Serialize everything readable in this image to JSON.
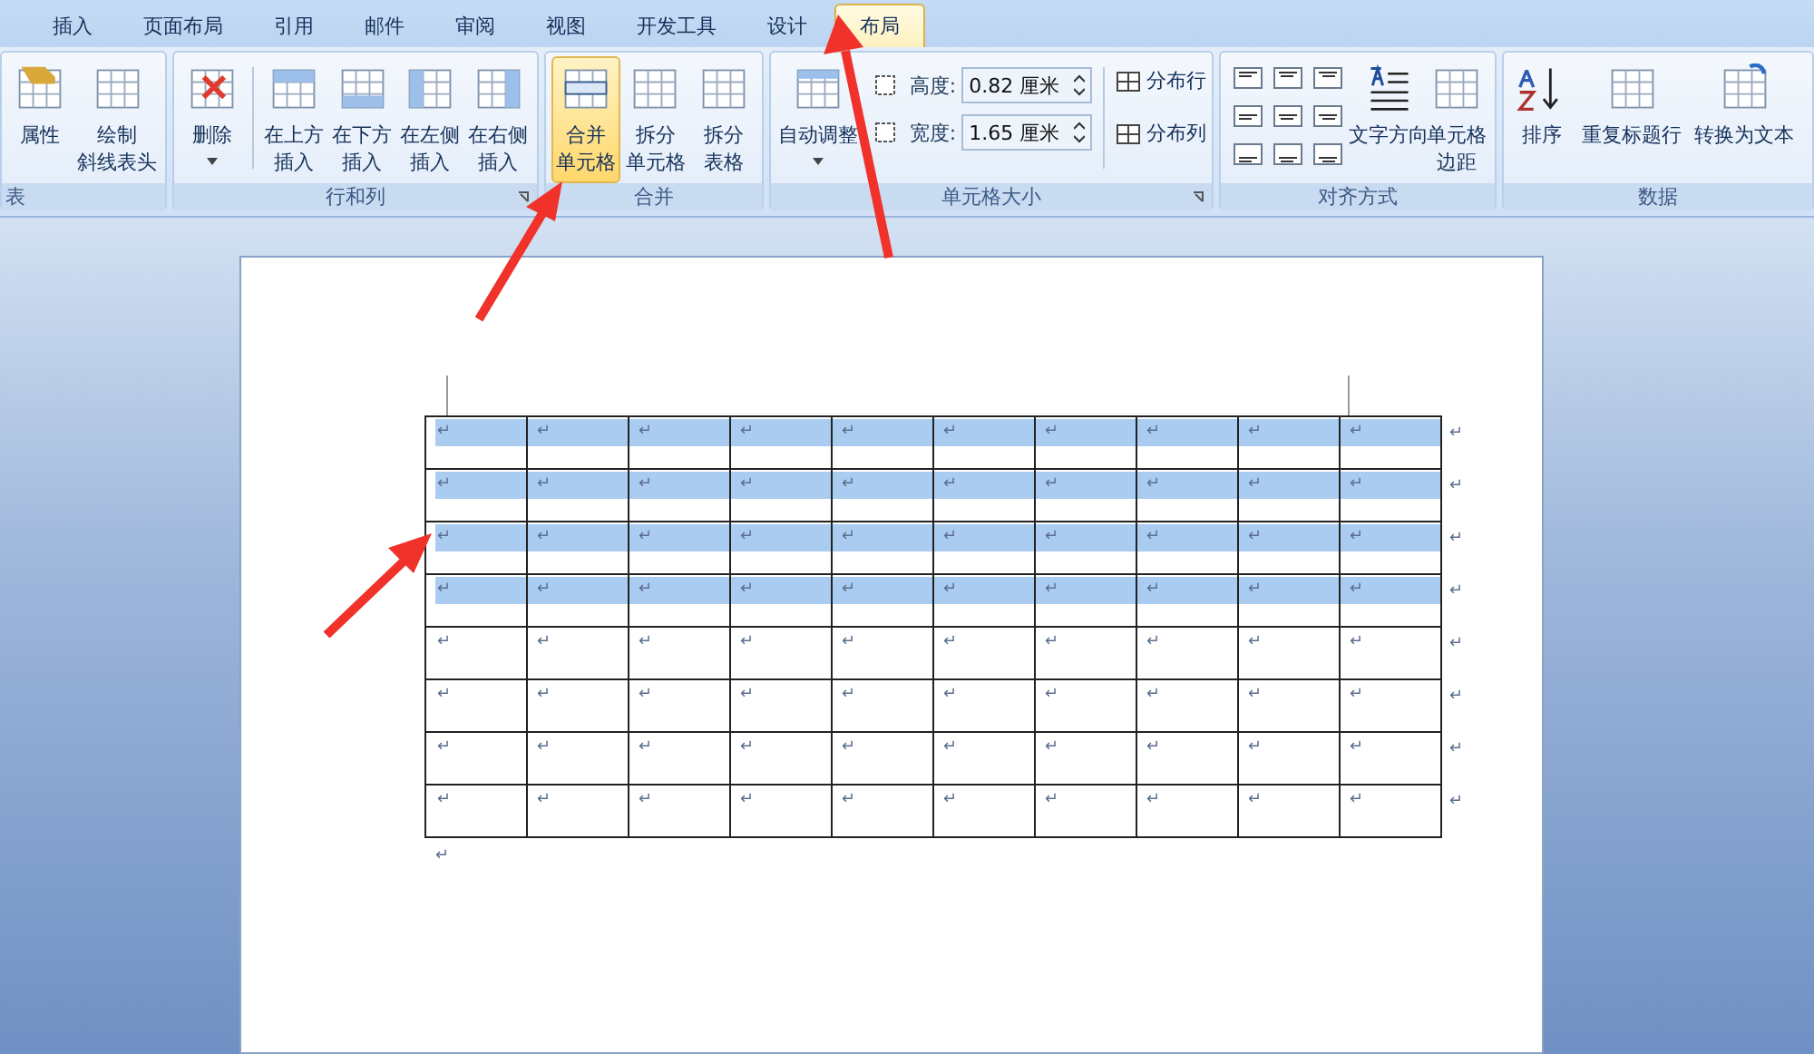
{
  "tabs": [
    {
      "label": "插入",
      "selected": false
    },
    {
      "label": "页面布局",
      "selected": false
    },
    {
      "label": "引用",
      "selected": false
    },
    {
      "label": "邮件",
      "selected": false
    },
    {
      "label": "审阅",
      "selected": false
    },
    {
      "label": "视图",
      "selected": false
    },
    {
      "label": "开发工具",
      "selected": false
    },
    {
      "label": "设计",
      "selected": false
    },
    {
      "label": "布局",
      "selected": true
    }
  ],
  "ribbon_groups": [
    {
      "label": "表",
      "controls": [
        {
          "kind": "large",
          "lines": [
            "属性"
          ],
          "dropdown": false,
          "highlighted": false
        },
        {
          "kind": "large",
          "lines": [
            "绘制",
            "斜线表头"
          ],
          "dropdown": false,
          "highlighted": false
        }
      ]
    },
    {
      "label": "行和列",
      "launcher": true,
      "controls": [
        {
          "kind": "large",
          "lines": [
            "删除"
          ],
          "dropdown": true,
          "highlighted": false
        },
        {
          "kind": "separator"
        },
        {
          "kind": "large",
          "lines": [
            "在上方",
            "插入"
          ],
          "dropdown": false,
          "highlighted": false
        },
        {
          "kind": "large",
          "lines": [
            "在下方",
            "插入"
          ],
          "dropdown": false,
          "highlighted": false
        },
        {
          "kind": "large",
          "lines": [
            "在左侧",
            "插入"
          ],
          "dropdown": false,
          "highlighted": false
        },
        {
          "kind": "large",
          "lines": [
            "在右侧",
            "插入"
          ],
          "dropdown": false,
          "highlighted": false
        }
      ]
    },
    {
      "label": "合并",
      "controls": [
        {
          "kind": "large",
          "lines": [
            "合并",
            "单元格"
          ],
          "dropdown": false,
          "highlighted": true
        },
        {
          "kind": "large",
          "lines": [
            "拆分",
            "单元格"
          ],
          "dropdown": false,
          "highlighted": false
        },
        {
          "kind": "large",
          "lines": [
            "拆分",
            "表格"
          ],
          "dropdown": false,
          "highlighted": false
        }
      ]
    },
    {
      "label": "单元格大小",
      "launcher": true,
      "controls": [
        {
          "kind": "large",
          "lines": [
            "自动调整"
          ],
          "dropdown": true,
          "highlighted": false
        },
        {
          "kind": "fields",
          "fields": [
            {
              "label": "高度:",
              "value": "0.82 厘米"
            },
            {
              "label": "宽度:",
              "value": "1.65 厘米"
            }
          ]
        },
        {
          "kind": "separator"
        },
        {
          "kind": "small",
          "items": [
            "分布行",
            "分布列"
          ]
        }
      ]
    },
    {
      "label": "对齐方式",
      "controls": [
        {
          "kind": "align_grid"
        },
        {
          "kind": "large",
          "lines": [
            "文字方向"
          ],
          "dropdown": false,
          "highlighted": false
        },
        {
          "kind": "large",
          "lines": [
            "单元格",
            "边距"
          ],
          "dropdown": false,
          "highlighted": false
        }
      ]
    },
    {
      "label": "数据",
      "controls": [
        {
          "kind": "large",
          "lines": [
            "排序"
          ],
          "dropdown": false,
          "highlighted": false
        },
        {
          "kind": "large",
          "lines": [
            "重复标题行"
          ],
          "dropdown": false,
          "highlighted": false
        },
        {
          "kind": "large",
          "lines": [
            "转换为文本"
          ],
          "dropdown": false,
          "highlighted": false
        }
      ]
    }
  ],
  "table": {
    "rows": [
      {
        "selected": true,
        "cells": [
          "↵",
          "↵",
          "↵",
          "↵",
          "↵",
          "↵",
          "↵",
          "↵",
          "↵",
          "↵"
        ],
        "end_mark": "↵"
      },
      {
        "selected": true,
        "cells": [
          "↵",
          "↵",
          "↵",
          "↵",
          "↵",
          "↵",
          "↵",
          "↵",
          "↵",
          "↵"
        ],
        "end_mark": "↵"
      },
      {
        "selected": true,
        "cells": [
          "↵",
          "↵",
          "↵",
          "↵",
          "↵",
          "↵",
          "↵",
          "↵",
          "↵",
          "↵"
        ],
        "end_mark": "↵"
      },
      {
        "selected": true,
        "cells": [
          "↵",
          "↵",
          "↵",
          "↵",
          "↵",
          "↵",
          "↵",
          "↵",
          "↵",
          "↵"
        ],
        "end_mark": "↵"
      },
      {
        "selected": false,
        "cells": [
          "↵",
          "↵",
          "↵",
          "↵",
          "↵",
          "↵",
          "↵",
          "↵",
          "↵",
          "↵"
        ],
        "end_mark": "↵"
      },
      {
        "selected": false,
        "cells": [
          "↵",
          "↵",
          "↵",
          "↵",
          "↵",
          "↵",
          "↵",
          "↵",
          "↵",
          "↵"
        ],
        "end_mark": "↵"
      },
      {
        "selected": false,
        "cells": [
          "↵",
          "↵",
          "↵",
          "↵",
          "↵",
          "↵",
          "↵",
          "↵",
          "↵",
          "↵"
        ],
        "end_mark": "↵"
      },
      {
        "selected": false,
        "cells": [
          "↵",
          "↵",
          "↵",
          "↵",
          "↵",
          "↵",
          "↵",
          "↵",
          "↵",
          "↵"
        ],
        "end_mark": "↵"
      }
    ],
    "after_mark": "↵"
  }
}
